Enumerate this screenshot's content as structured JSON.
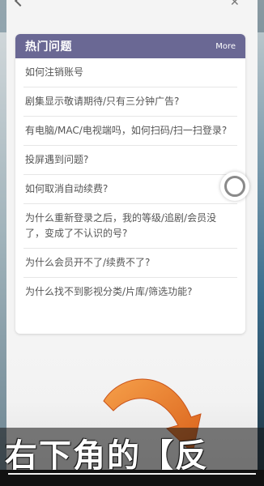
{
  "faq": {
    "title": "热门问题",
    "more_label": "More",
    "items": [
      "如何注销账号",
      "剧集显示敬请期待/只有三分钟广告?",
      "有电脑/MAC/电视端吗，如何扫码/扫一扫登录?",
      "投屏遇到问题?",
      "如何取消自动续费?",
      "为什么重新登录之后，我的等级/追剧/会员没了，变成了不认识的号?",
      "为什么会员开不了/续费不了?",
      "为什么找不到影视分类/片库/筛选功能?"
    ]
  },
  "caption": "右下角的【反",
  "colors": {
    "header_bg": "#6a6894",
    "arrow": "#e8791f"
  },
  "icons": {
    "back": "back-chevron-icon",
    "close": "close-icon",
    "float": "floating-assistive-ball-icon"
  }
}
